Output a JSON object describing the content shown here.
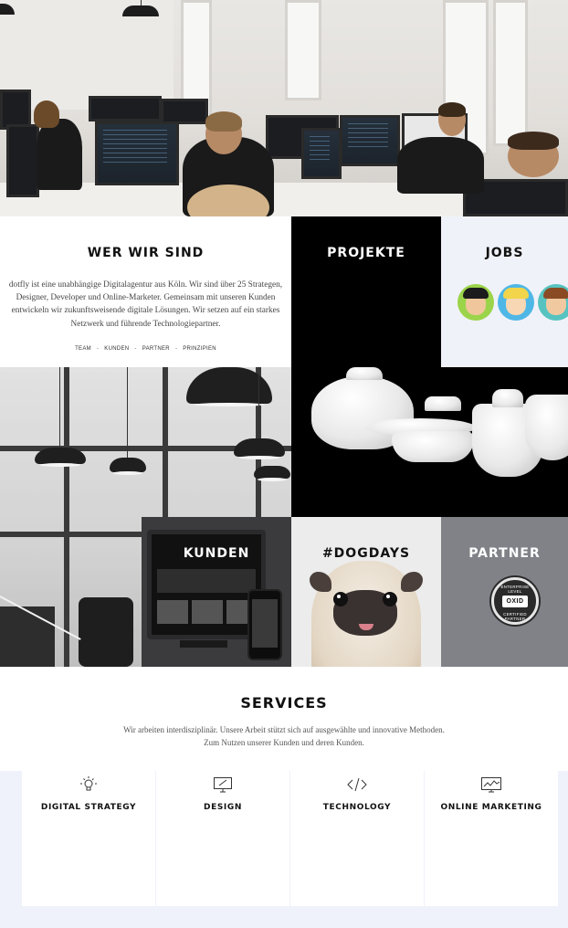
{
  "hero": {
    "alt_subject": "office-photo"
  },
  "about": {
    "title": "WER WIR SIND",
    "text": "dotfly ist eine unabhängige Digitalagentur aus Köln. Wir sind über 25 Strategen, Designer, Developer und Online-Marketer. Gemeinsam mit unseren Kunden entwickeln wir zukunftsweisende digitale Lösungen. Wir setzen auf ein starkes Netzwerk und führende Technologiepartner.",
    "links": [
      "TEAM",
      "KUNDEN",
      "PARTNER",
      "PRINZIPIEN"
    ],
    "separator": "-"
  },
  "tiles": {
    "projekte": "PROJEKTE",
    "jobs": "JOBS",
    "kunden": "KUNDEN",
    "dogdays": "#DOGDAYS",
    "partner": "PARTNER"
  },
  "partner_badge": {
    "top": "ENTERPRISE LEVEL",
    "main": "OXID",
    "bottom": "CERTIFIED PARTNER"
  },
  "services": {
    "title": "SERVICES",
    "text_line1": "Wir arbeiten interdisziplinär. Unsere Arbeit stützt sich auf ausgewählte und innovative Methoden.",
    "text_line2": "Zum Nutzen unserer Kunden und deren Kunden.",
    "cards": [
      {
        "label": "DIGITAL STRATEGY",
        "icon": "lightbulb-icon"
      },
      {
        "label": "DESIGN",
        "icon": "monitor-pen-icon"
      },
      {
        "label": "TECHNOLOGY",
        "icon": "code-icon"
      },
      {
        "label": "ONLINE MARKETING",
        "icon": "chart-monitor-icon"
      }
    ]
  },
  "colors": {
    "projekte_bg": "#000000",
    "jobs_bg": "#f0f2f9",
    "kunden_bg": "#3b3b3d",
    "partner_bg": "#808288",
    "services_area_bg": "#eff2fa"
  }
}
